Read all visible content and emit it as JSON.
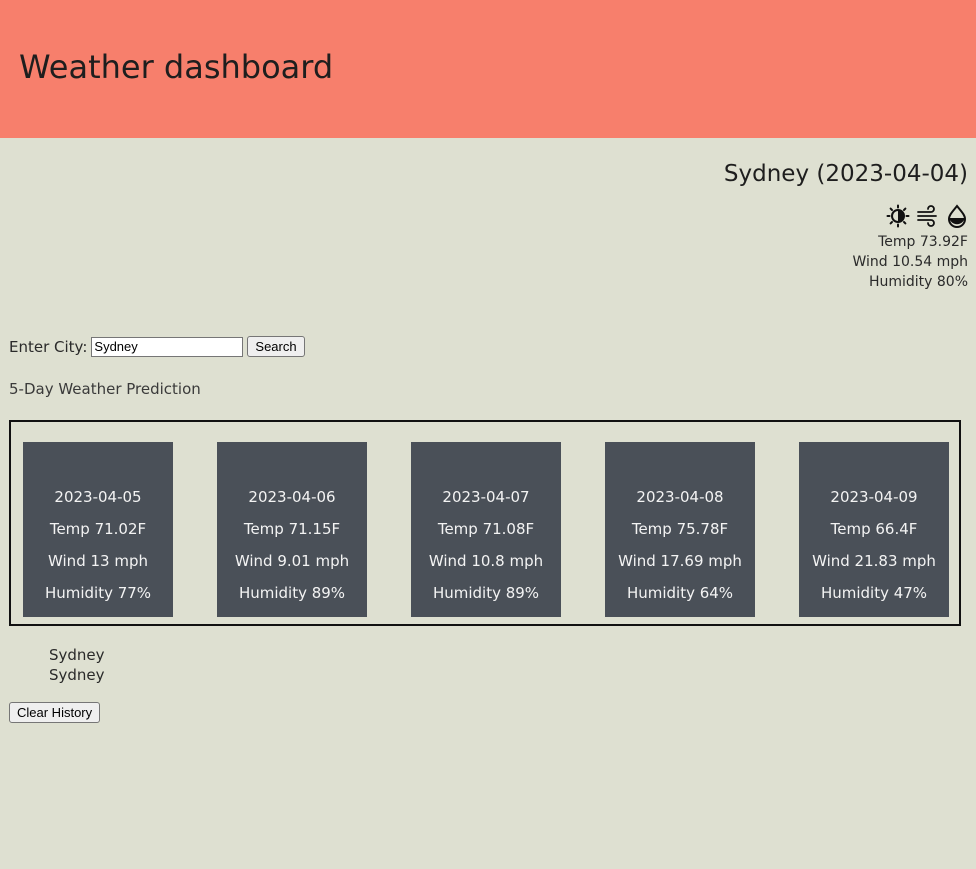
{
  "header": {
    "title": "Weather dashboard"
  },
  "current": {
    "title": "Sydney (2023-04-04)",
    "icons": [
      "sun-icon",
      "wind-icon",
      "humidity-drop-icon"
    ],
    "temp": "Temp 73.92F",
    "wind": "Wind 10.54 mph",
    "humidity": "Humidity 80%"
  },
  "search": {
    "label": "Enter City:",
    "value": "Sydney",
    "button_label": "Search"
  },
  "forecast": {
    "heading": "5-Day Weather Prediction",
    "days": [
      {
        "date": "2023-04-05",
        "temp": "Temp 71.02F",
        "wind": "Wind 13 mph",
        "humidity": "Humidity 77%"
      },
      {
        "date": "2023-04-06",
        "temp": "Temp 71.15F",
        "wind": "Wind 9.01 mph",
        "humidity": "Humidity 89%"
      },
      {
        "date": "2023-04-07",
        "temp": "Temp 71.08F",
        "wind": "Wind 10.8 mph",
        "humidity": "Humidity 89%"
      },
      {
        "date": "2023-04-08",
        "temp": "Temp 75.78F",
        "wind": "Wind 17.69 mph",
        "humidity": "Humidity 64%"
      },
      {
        "date": "2023-04-09",
        "temp": "Temp 66.4F",
        "wind": "Wind 21.83 mph",
        "humidity": "Humidity 47%"
      }
    ]
  },
  "history": {
    "items": [
      "Sydney",
      "Sydney"
    ],
    "clear_label": "Clear History"
  },
  "colors": {
    "header_bg": "#f77f6c",
    "page_bg": "#dee0d1",
    "card_bg": "#4a5058"
  }
}
